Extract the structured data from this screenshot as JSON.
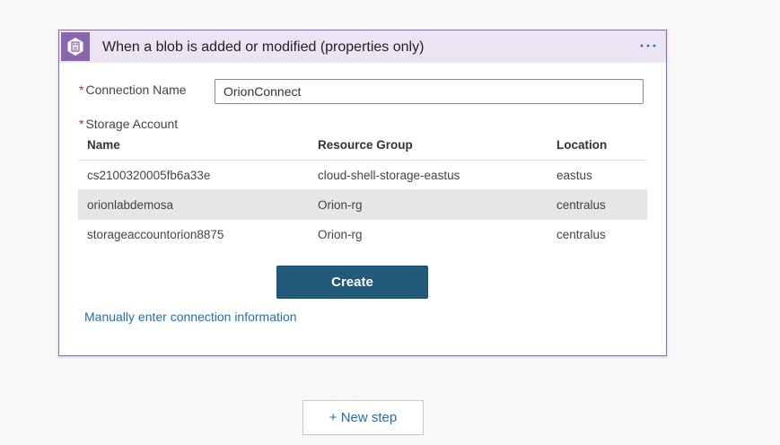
{
  "card": {
    "title": "When a blob is added or modified (properties only)",
    "icon": "blob-storage-icon",
    "more_icon": "ellipsis-icon",
    "accent": "#8a66ad"
  },
  "connection": {
    "required_mark": "*",
    "label": "Connection Name",
    "value": "OrionConnect"
  },
  "storage": {
    "required_mark": "*",
    "label": "Storage Account",
    "columns": [
      "Name",
      "Resource Group",
      "Location"
    ],
    "rows": [
      {
        "name": "cs2100320005fb6a33e",
        "resource_group": "cloud-shell-storage-eastus",
        "location": "eastus",
        "selected": false
      },
      {
        "name": "orionlabdemosa",
        "resource_group": "Orion-rg",
        "location": "centralus",
        "selected": true
      },
      {
        "name": "storageaccountorion8875",
        "resource_group": "Orion-rg",
        "location": "centralus",
        "selected": false
      }
    ]
  },
  "actions": {
    "create_label": "Create",
    "create_color": "#225a7c",
    "manual_link": "Manually enter connection information",
    "new_step_label": "+ New step",
    "link_color": "#1f6fb2"
  }
}
